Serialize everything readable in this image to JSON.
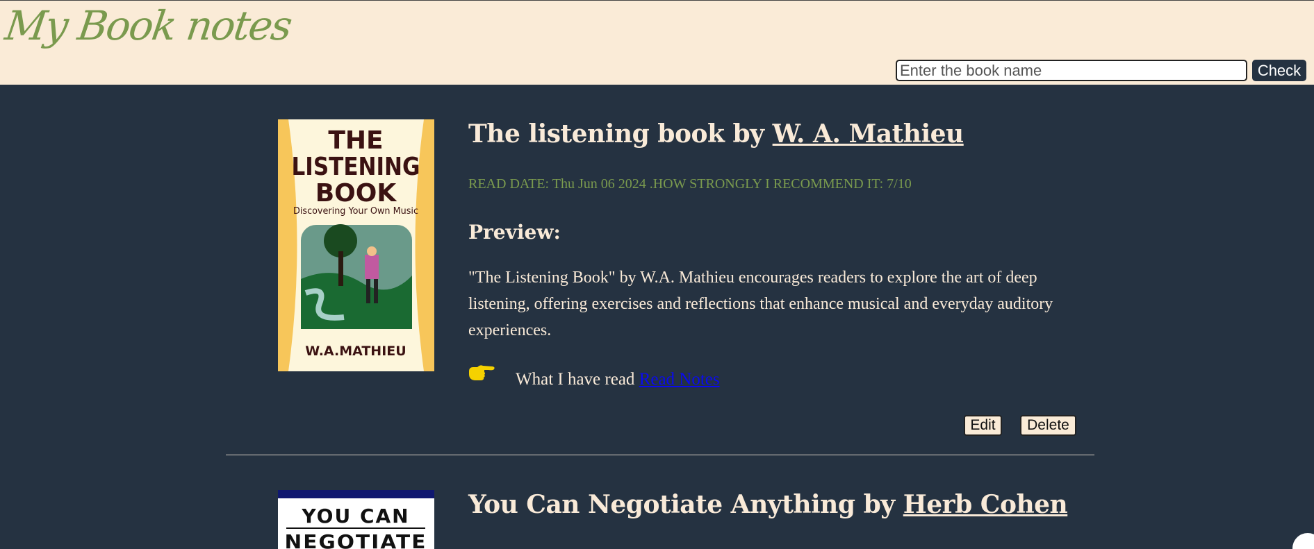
{
  "header": {
    "logo": "My Book notes",
    "search_placeholder": "Enter the book name",
    "check_label": "Check"
  },
  "books": [
    {
      "title": "The listening book",
      "by": "by",
      "author": "W. A. Mathieu",
      "meta": "READ DATE: Thu Jun 06 2024 .HOW STRONGLY I RECOMMEND IT: 7/10",
      "preview_label": "Preview:",
      "preview": "\"The Listening Book\" by W.A. Mathieu encourages readers to explore the art of deep listening, offering exercises and reflections that enhance musical and everyday auditory experiences.",
      "read_prefix": "What I have read",
      "read_link": "Read Notes",
      "edit_label": "Edit",
      "delete_label": "Delete",
      "cover": {
        "line1": "THE",
        "line2": "LISTENING",
        "line3": "BOOK",
        "subtitle": "Discovering Your Own Music",
        "author": "W.A.MATHIEU"
      }
    },
    {
      "title": "You Can Negotiate Anything",
      "by": "by",
      "author": "Herb Cohen",
      "cover": {
        "line1": "YOU CAN",
        "line2": "NEGOTIATE"
      }
    }
  ],
  "colors": {
    "background": "#253241",
    "header": "#faebd7",
    "accent_green": "#7a9a4e",
    "text": "#f9ead8",
    "link": "#0a0af0"
  }
}
